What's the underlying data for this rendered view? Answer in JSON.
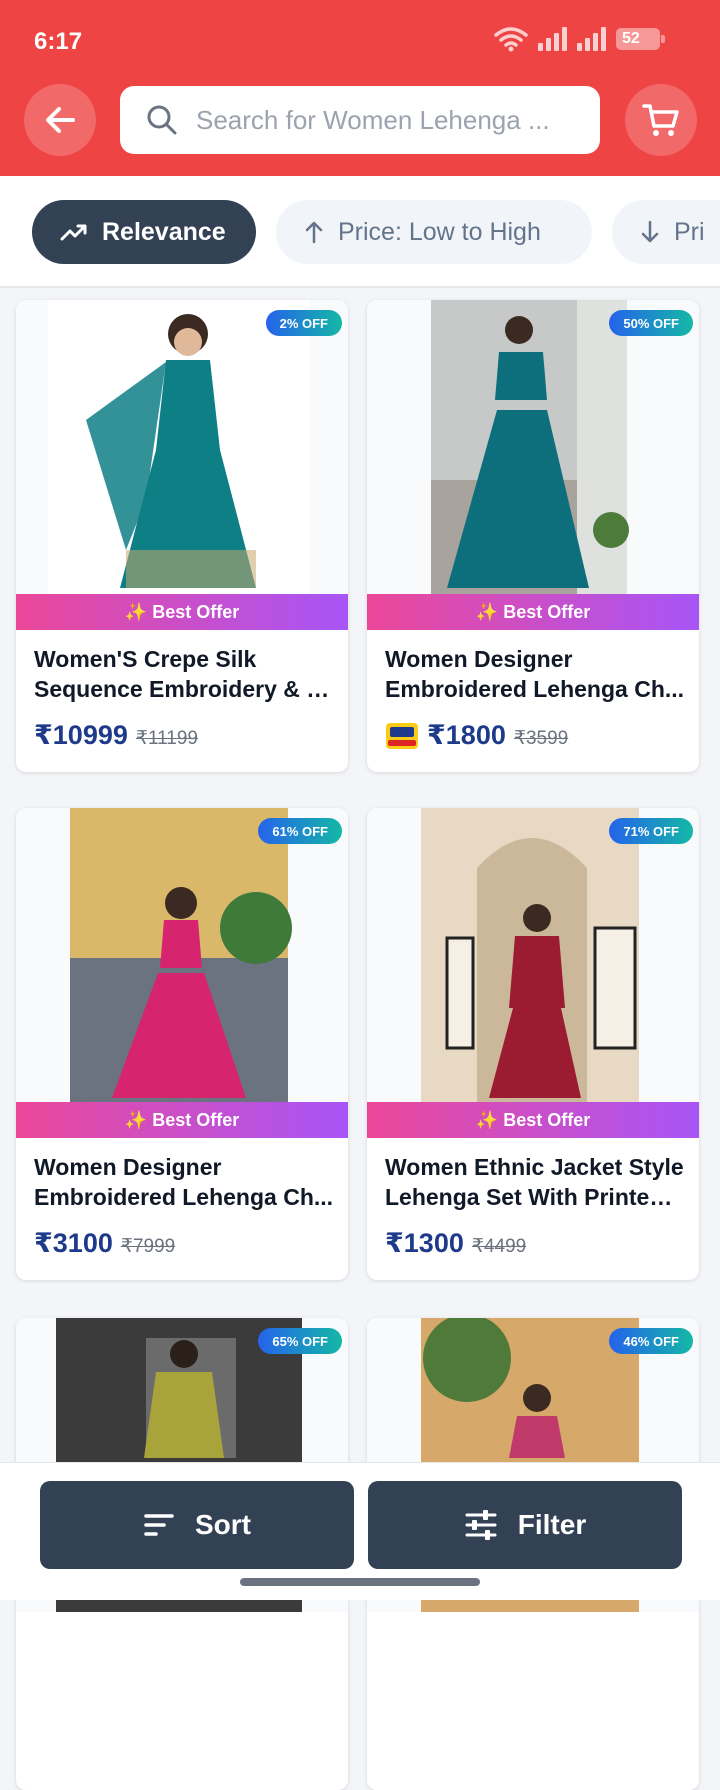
{
  "status_bar": {
    "time": "6:17",
    "battery": "52"
  },
  "header": {
    "search_placeholder": "Search for Women Lehenga ..."
  },
  "sort_chips": [
    {
      "label": "Relevance",
      "active": true,
      "icon": "trending-up-icon"
    },
    {
      "label": "Price: Low to High",
      "active": false,
      "icon": "arrow-up-icon"
    },
    {
      "label": "Pri",
      "active": false,
      "icon": "arrow-down-icon"
    }
  ],
  "best_offer_label": "✨ Best Offer",
  "products": [
    {
      "title_line1": "Women'S Crepe Silk",
      "title_line2": "Sequence Embroidery & Z...",
      "price": "₹10999",
      "mrp": "₹11199",
      "discount": "2% OFF",
      "wow_badge": false,
      "dress_color": "#0f7f86"
    },
    {
      "title_line1": "Women Designer",
      "title_line2": "Embroidered Lehenga Ch...",
      "price": "₹1800",
      "mrp": "₹3599",
      "discount": "50% OFF",
      "wow_badge": true,
      "dress_color": "#0e6f7c"
    },
    {
      "title_line1": "Women Designer",
      "title_line2": "Embroidered Lehenga Ch...",
      "price": "₹3100",
      "mrp": "₹7999",
      "discount": "61% OFF",
      "wow_badge": false,
      "dress_color": "#d6246e"
    },
    {
      "title_line1": "Women Ethnic Jacket Style",
      "title_line2": "Lehenga Set With Printed ...",
      "price": "₹1300",
      "mrp": "₹4499",
      "discount": "71% OFF",
      "wow_badge": false,
      "dress_color": "#9b1b30"
    },
    {
      "discount": "65% OFF",
      "dress_color": "#a8a33a"
    },
    {
      "discount": "46% OFF",
      "dress_color": "#c03a6a"
    }
  ],
  "bottom_bar": {
    "sort_label": "Sort",
    "filter_label": "Filter"
  }
}
